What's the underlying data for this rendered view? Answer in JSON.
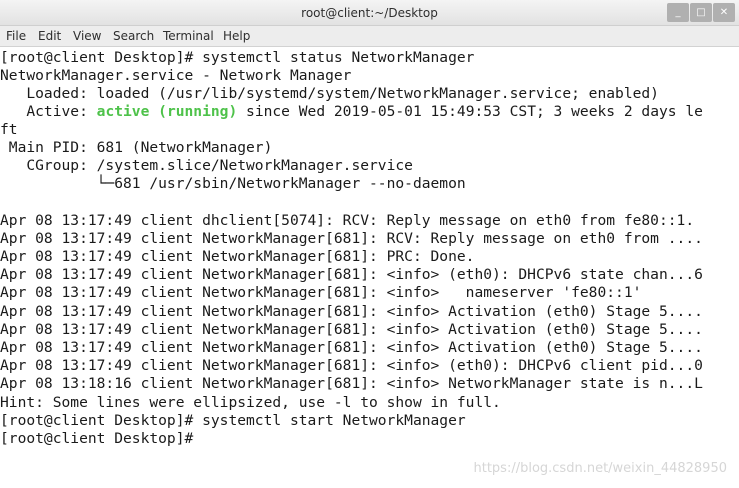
{
  "window": {
    "title": "root@client:~/Desktop",
    "controls": {
      "minimize": "_",
      "maximize": "□",
      "close": "✕"
    }
  },
  "menubar": [
    "File",
    "Edit",
    "View",
    "Search",
    "Terminal",
    "Help"
  ],
  "terminal": {
    "lines": [
      "[root@client Desktop]# systemctl status NetworkManager",
      "NetworkManager.service - Network Manager",
      "   Loaded: loaded (/usr/lib/systemd/system/NetworkManager.service; enabled)",
      {
        "prefix": "   Active: ",
        "highlight": "active (running)",
        "suffix": " since Wed 2019-05-01 15:49:53 CST; 3 weeks 2 days le"
      },
      "ft",
      " Main PID: 681 (NetworkManager)",
      "   CGroup: /system.slice/NetworkManager.service",
      "           └─681 /usr/sbin/NetworkManager --no-daemon",
      "",
      "Apr 08 13:17:49 client dhclient[5074]: RCV: Reply message on eth0 from fe80::1.",
      "Apr 08 13:17:49 client NetworkManager[681]: RCV: Reply message on eth0 from ....",
      "Apr 08 13:17:49 client NetworkManager[681]: PRC: Done.",
      "Apr 08 13:17:49 client NetworkManager[681]: <info> (eth0): DHCPv6 state chan...6",
      "Apr 08 13:17:49 client NetworkManager[681]: <info>   nameserver 'fe80::1'",
      "Apr 08 13:17:49 client NetworkManager[681]: <info> Activation (eth0) Stage 5....",
      "Apr 08 13:17:49 client NetworkManager[681]: <info> Activation (eth0) Stage 5....",
      "Apr 08 13:17:49 client NetworkManager[681]: <info> Activation (eth0) Stage 5....",
      "Apr 08 13:17:49 client NetworkManager[681]: <info> (eth0): DHCPv6 client pid...0",
      "Apr 08 13:18:16 client NetworkManager[681]: <info> NetworkManager state is n...L",
      "Hint: Some lines were ellipsized, use -l to show in full.",
      "[root@client Desktop]# systemctl start NetworkManager",
      "[root@client Desktop]# "
    ],
    "colors": {
      "foreground": "#1a1a1a",
      "active_status": "#4ec24a",
      "background": "#ffffff"
    }
  },
  "watermark": "https://blog.csdn.net/weixin_44828950"
}
